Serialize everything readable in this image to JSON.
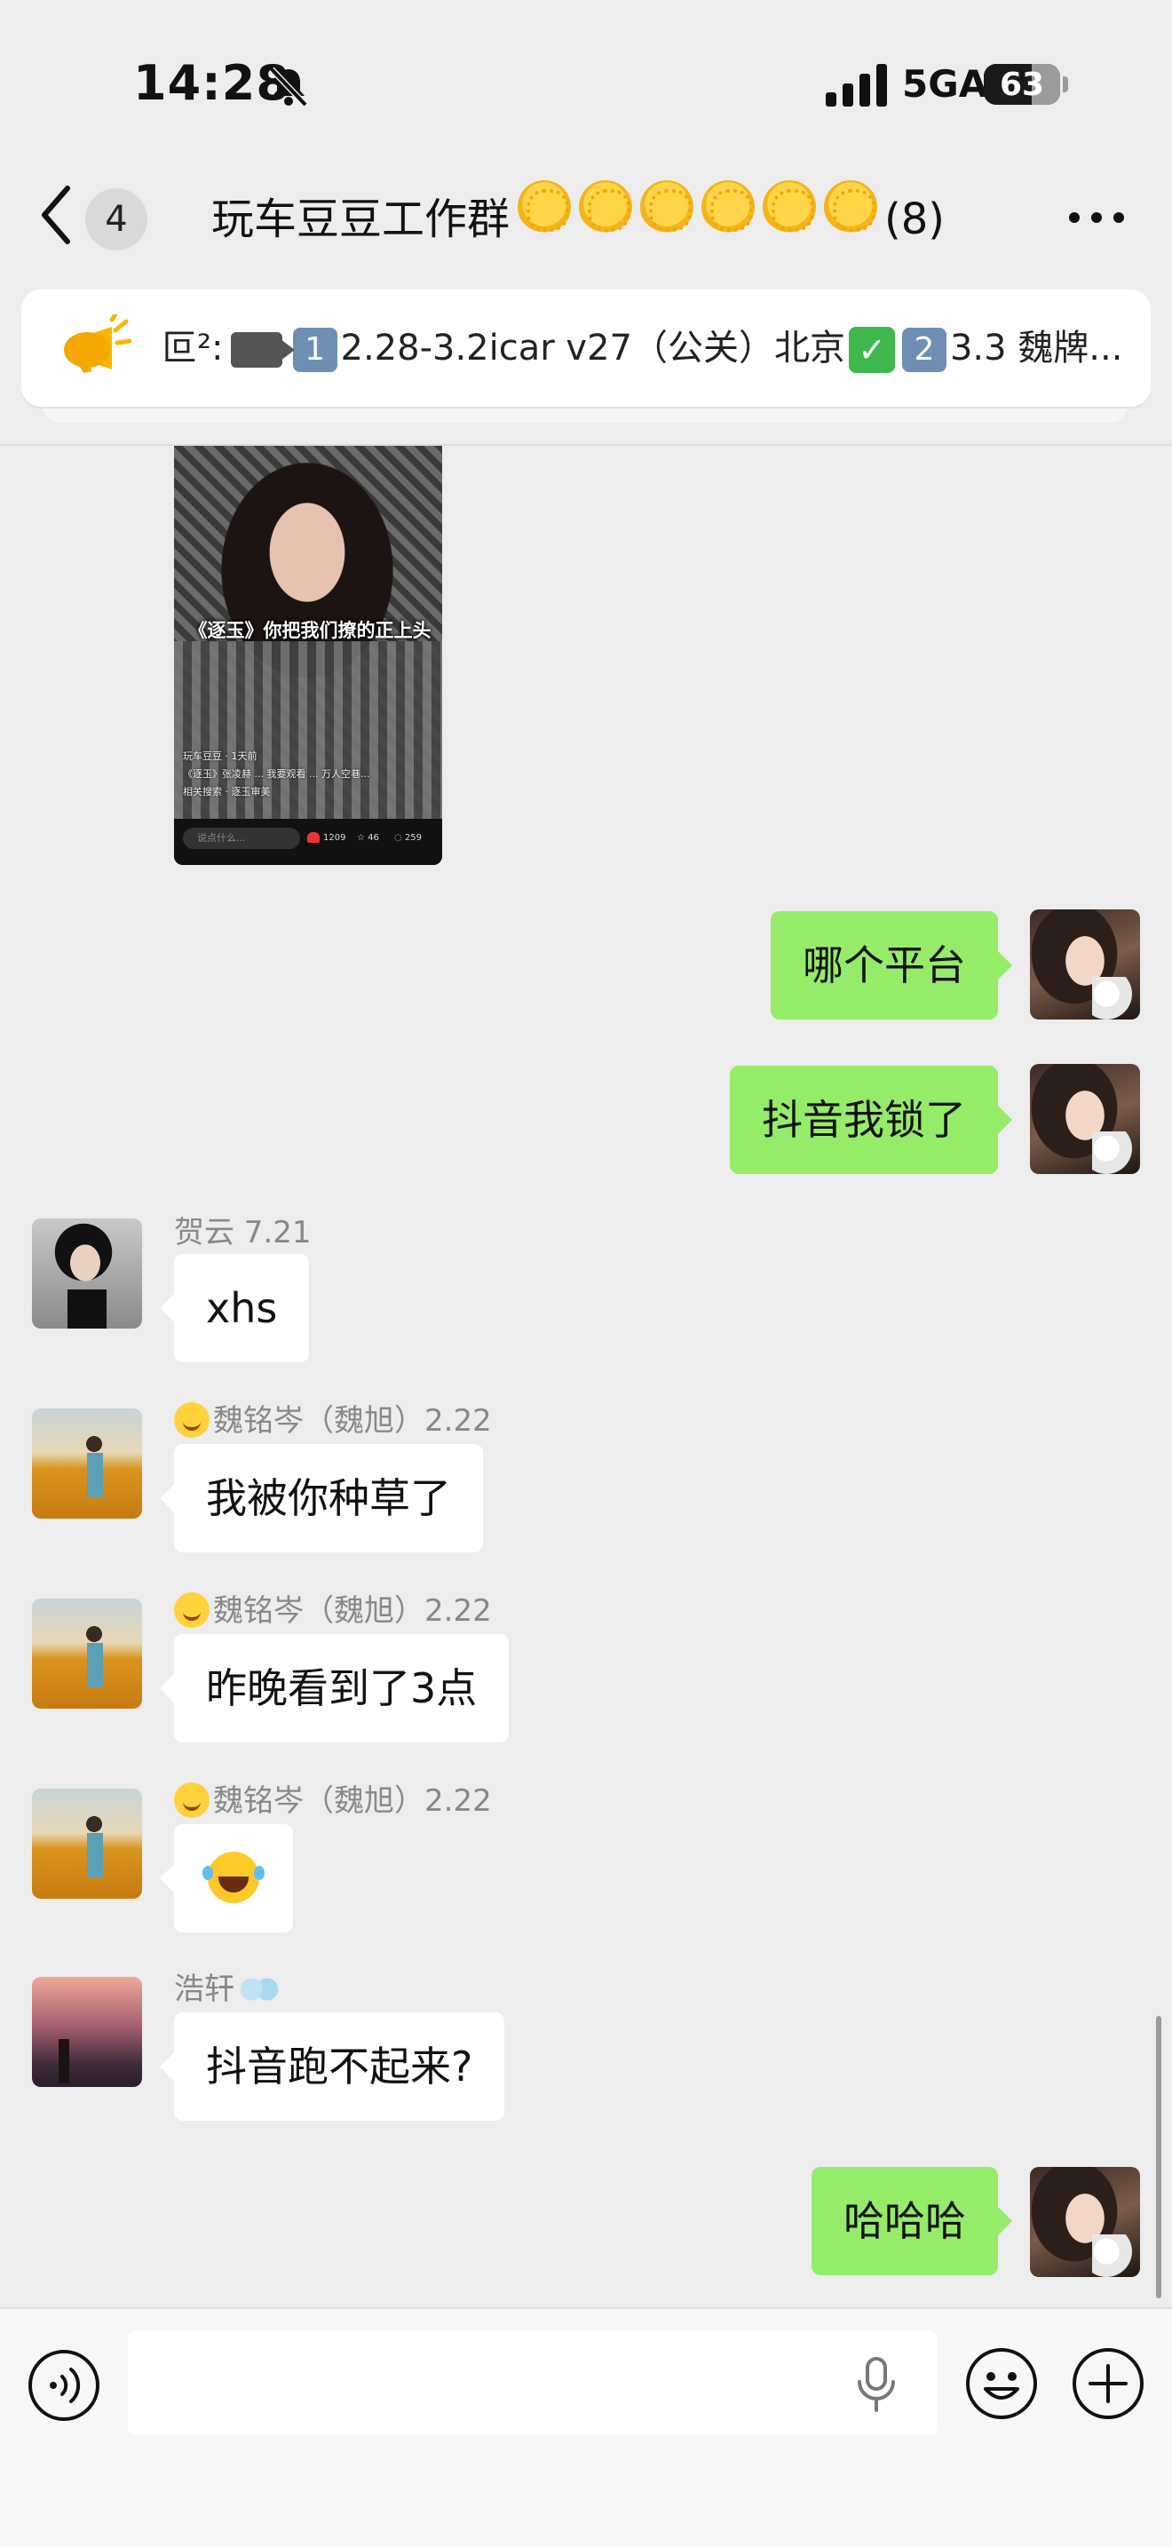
{
  "status_bar": {
    "time": "14:28",
    "network": "5GA",
    "battery_level": "63",
    "icons": [
      "bell-muted-icon",
      "signal-bars-icon",
      "battery-icon"
    ]
  },
  "nav": {
    "unread_count": "4",
    "title": "玩车豆豆工作群",
    "title_emoji_count": 6,
    "member_count": "(8)",
    "icons": [
      "back-chevron-icon",
      "more-dots-icon"
    ]
  },
  "announcement": {
    "prefix": "叵²:",
    "num1": "1",
    "item1": "2.28-3.2icar v27（公关）北京",
    "num2": "2",
    "item2": "3.3 魏牌...",
    "icons": [
      "megaphone-icon",
      "camera-icon",
      "checkmark-icon"
    ]
  },
  "video": {
    "caption": "《逐玉》你把我们撩的正上头",
    "author": "玩车豆豆 · 1天前",
    "description": "《逐玉》张凌赫 ... 我要观看 ... 万人空巷...",
    "related": "相关搜索 · 逐玉审美",
    "input_placeholder": "说点什么...",
    "likes": "1209",
    "favorites": "46",
    "comments": "259"
  },
  "messages": [
    {
      "side": "out",
      "text": "哪个平台"
    },
    {
      "side": "out",
      "text": "抖音我锁了"
    },
    {
      "side": "in",
      "sender": "贺云 7.21",
      "text": "xhs"
    },
    {
      "side": "in",
      "sender": "魏铭岑（魏旭）2.22",
      "text": "我被你种草了"
    },
    {
      "side": "in",
      "sender": "魏铭岑（魏旭）2.22",
      "text": "昨晚看到了3点"
    },
    {
      "side": "in",
      "sender": "魏铭岑（魏旭）2.22",
      "text": ""
    },
    {
      "side": "in",
      "sender": "浩轩",
      "text": "抖音跑不起来?"
    },
    {
      "side": "out",
      "text": "哈哈哈"
    }
  ],
  "input_bar": {
    "placeholder": "",
    "icons": [
      "voice-icon",
      "microphone-icon",
      "emoji-icon",
      "plus-icon"
    ]
  },
  "colors": {
    "outgoing_bubble": "#95ec69",
    "incoming_bubble": "#ffffff",
    "background": "#ededed"
  }
}
